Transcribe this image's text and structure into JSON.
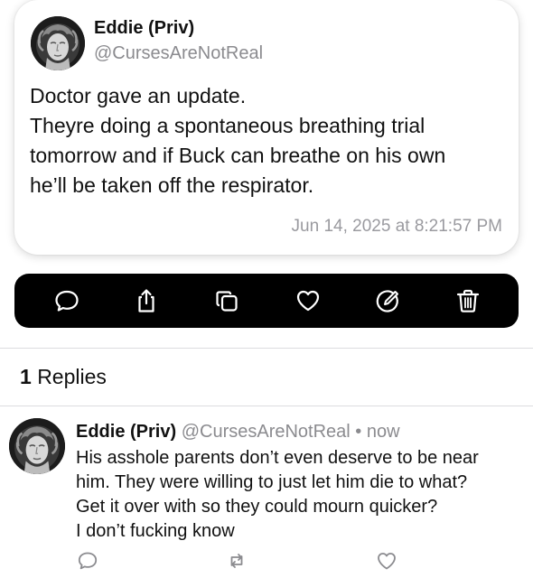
{
  "post": {
    "author_name": "Eddie (Priv)",
    "author_handle": "@CursesAreNotReal",
    "avatar_icon": "statue-head-avatar",
    "body_lines": [
      "Doctor gave an update.",
      "Theyre doing a spontaneous breathing trial",
      "tomorrow and if Buck can breathe on his own",
      "he’ll be taken off the respirator."
    ],
    "timestamp": "Jun 14, 2025 at 8:21:57 PM"
  },
  "action_bar": {
    "background": "#000000",
    "icon_color": "#ffffff",
    "actions": [
      "comment-icon",
      "share-icon",
      "copy-icon",
      "heart-icon",
      "edit-icon",
      "trash-icon"
    ]
  },
  "replies": {
    "count": "1",
    "label": "Replies"
  },
  "reply": {
    "author_name": "Eddie (Priv)",
    "author_handle": "@CursesAreNotReal",
    "separator": "•",
    "time": "now",
    "body_lines": [
      "His asshole parents don’t even deserve to be near",
      "him. They were willing to just let him die to what?",
      "Get it over with so they could mourn quicker?",
      "I don’t fucking know"
    ],
    "actions": [
      "comment-icon",
      "repost-icon",
      "heart-icon"
    ]
  }
}
